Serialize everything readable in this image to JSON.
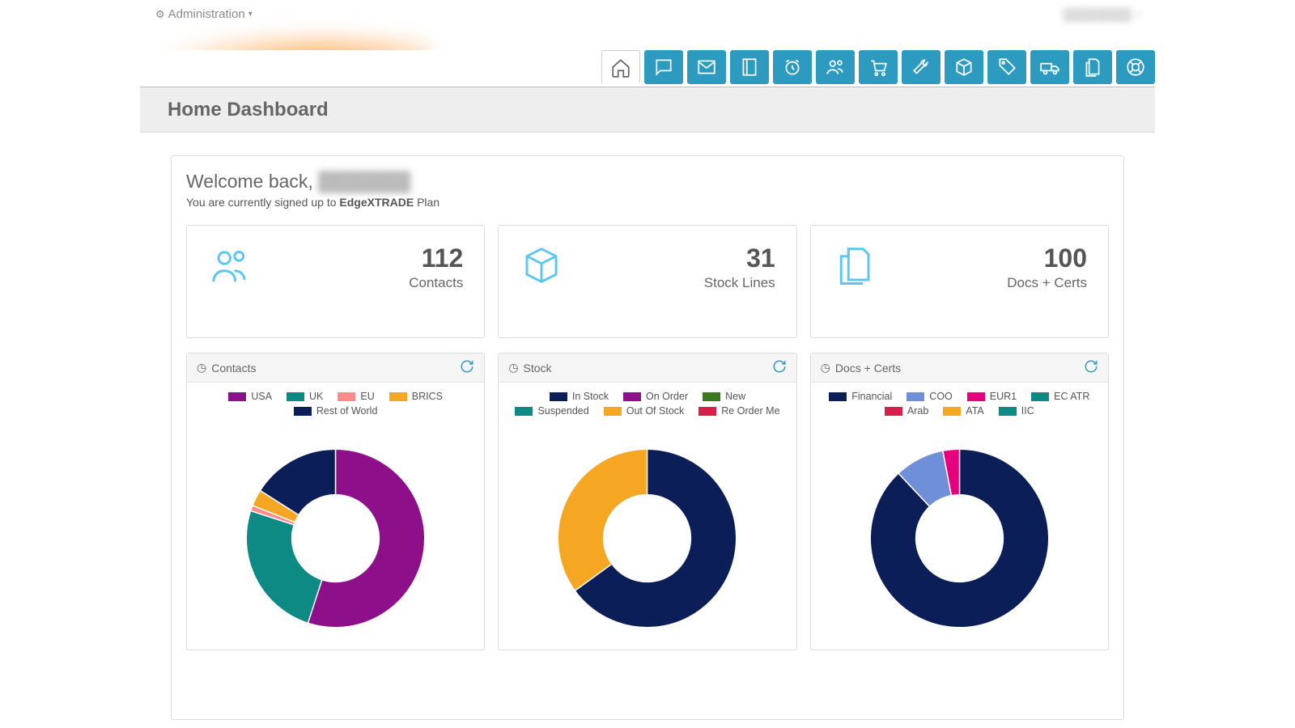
{
  "header": {
    "admin_label": "Administration",
    "page_title": "Home Dashboard"
  },
  "welcome": {
    "greeting": "Welcome back, ",
    "subscribed_prefix": "You are currently signed up to ",
    "plan_name": "EdgeXTRADE",
    "plan_suffix": " Plan"
  },
  "stats": [
    {
      "value": "112",
      "label": "Contacts"
    },
    {
      "value": "31",
      "label": "Stock Lines"
    },
    {
      "value": "100",
      "label": "Docs + Certs"
    }
  ],
  "panels": [
    {
      "title": "Contacts"
    },
    {
      "title": "Stock"
    },
    {
      "title": "Docs + Certs"
    }
  ],
  "chart_data": [
    {
      "type": "pie",
      "title": "Contacts",
      "series": [
        {
          "name": "USA",
          "value": 55,
          "color": "#8e0f8a"
        },
        {
          "name": "UK",
          "value": 25,
          "color": "#0d8a84"
        },
        {
          "name": "EU",
          "value": 1,
          "color": "#ff8a8a"
        },
        {
          "name": "BRICS",
          "value": 3,
          "color": "#f5a623"
        },
        {
          "name": "Rest of World",
          "value": 16,
          "color": "#0b1e58"
        }
      ]
    },
    {
      "type": "pie",
      "title": "Stock",
      "series": [
        {
          "name": "In Stock",
          "value": 65,
          "color": "#0b1e58"
        },
        {
          "name": "On Order",
          "value": 0,
          "color": "#8e0f8a"
        },
        {
          "name": "New",
          "value": 0,
          "color": "#3a7a1f"
        },
        {
          "name": "Suspended",
          "value": 0,
          "color": "#0d8a84"
        },
        {
          "name": "Out Of Stock",
          "value": 35,
          "color": "#f5a623"
        },
        {
          "name": "Re Order Me",
          "value": 0,
          "color": "#d6204b"
        }
      ]
    },
    {
      "type": "pie",
      "title": "Docs + Certs",
      "series": [
        {
          "name": "Financial",
          "value": 88,
          "color": "#0b1e58"
        },
        {
          "name": "COO",
          "value": 9,
          "color": "#6f8fd8"
        },
        {
          "name": "EUR1",
          "value": 3,
          "color": "#e6007e"
        },
        {
          "name": "EC ATR",
          "value": 0,
          "color": "#0d8a84"
        },
        {
          "name": "Arab",
          "value": 0,
          "color": "#d6204b"
        },
        {
          "name": "ATA",
          "value": 0,
          "color": "#f5a623"
        },
        {
          "name": "IIC",
          "value": 0,
          "color": "#0d8a84"
        }
      ]
    }
  ]
}
